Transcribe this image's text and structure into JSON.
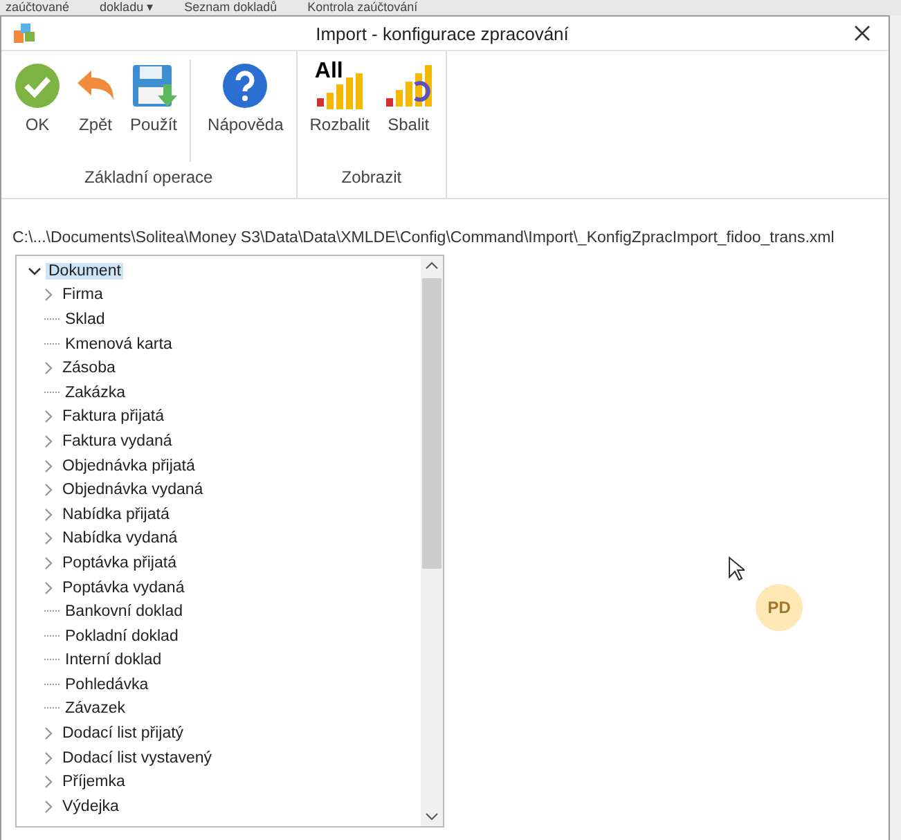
{
  "background_app": {
    "tabs": [
      "zaúčtované",
      "dokladu ▾",
      "Seznam dokladů",
      "Kontrola zaúčtování"
    ]
  },
  "window": {
    "title": "Import - konfigurace zpracování"
  },
  "ribbon": {
    "groups": [
      {
        "label": "Základní operace",
        "buttons": [
          {
            "kind": "ok",
            "label": "OK"
          },
          {
            "kind": "back",
            "label": "Zpět"
          },
          {
            "kind": "save",
            "label": "Použít"
          },
          {
            "kind": "help",
            "label": "Nápověda"
          }
        ]
      },
      {
        "label": "Zobrazit",
        "buttons": [
          {
            "kind": "expand",
            "label": "Rozbalit",
            "icon_text": "All"
          },
          {
            "kind": "collapse",
            "label": "Sbalit"
          }
        ]
      }
    ]
  },
  "path": "C:\\...\\Documents\\Solitea\\Money S3\\Data\\Data\\XMLDE\\Config\\Command\\Import\\_KonfigZpracImport_fidoo_trans.xml",
  "tree": {
    "label": "Dokument",
    "expanded": true,
    "selected": true,
    "children": [
      {
        "label": "Firma",
        "kind": "group"
      },
      {
        "label": "Sklad",
        "kind": "leaf"
      },
      {
        "label": "Kmenová karta",
        "kind": "leaf"
      },
      {
        "label": "Zásoba",
        "kind": "group"
      },
      {
        "label": "Zakázka",
        "kind": "leaf"
      },
      {
        "label": "Faktura přijatá",
        "kind": "group"
      },
      {
        "label": "Faktura vydaná",
        "kind": "group"
      },
      {
        "label": "Objednávka přijatá",
        "kind": "group"
      },
      {
        "label": "Objednávka vydaná",
        "kind": "group"
      },
      {
        "label": "Nabídka přijatá",
        "kind": "group"
      },
      {
        "label": "Nabídka vydaná",
        "kind": "group"
      },
      {
        "label": "Poptávka přijatá",
        "kind": "group"
      },
      {
        "label": "Poptávka vydaná",
        "kind": "group"
      },
      {
        "label": "Bankovní doklad",
        "kind": "leaf"
      },
      {
        "label": "Pokladní doklad",
        "kind": "leaf"
      },
      {
        "label": "Interní doklad",
        "kind": "leaf"
      },
      {
        "label": "Pohledávka",
        "kind": "leaf"
      },
      {
        "label": "Závazek",
        "kind": "leaf"
      },
      {
        "label": "Dodací list přijatý",
        "kind": "group"
      },
      {
        "label": "Dodací list vystavený",
        "kind": "group"
      },
      {
        "label": "Příjemka",
        "kind": "group"
      },
      {
        "label": "Výdejka",
        "kind": "group"
      }
    ]
  },
  "avatar": {
    "initials": "PD"
  }
}
